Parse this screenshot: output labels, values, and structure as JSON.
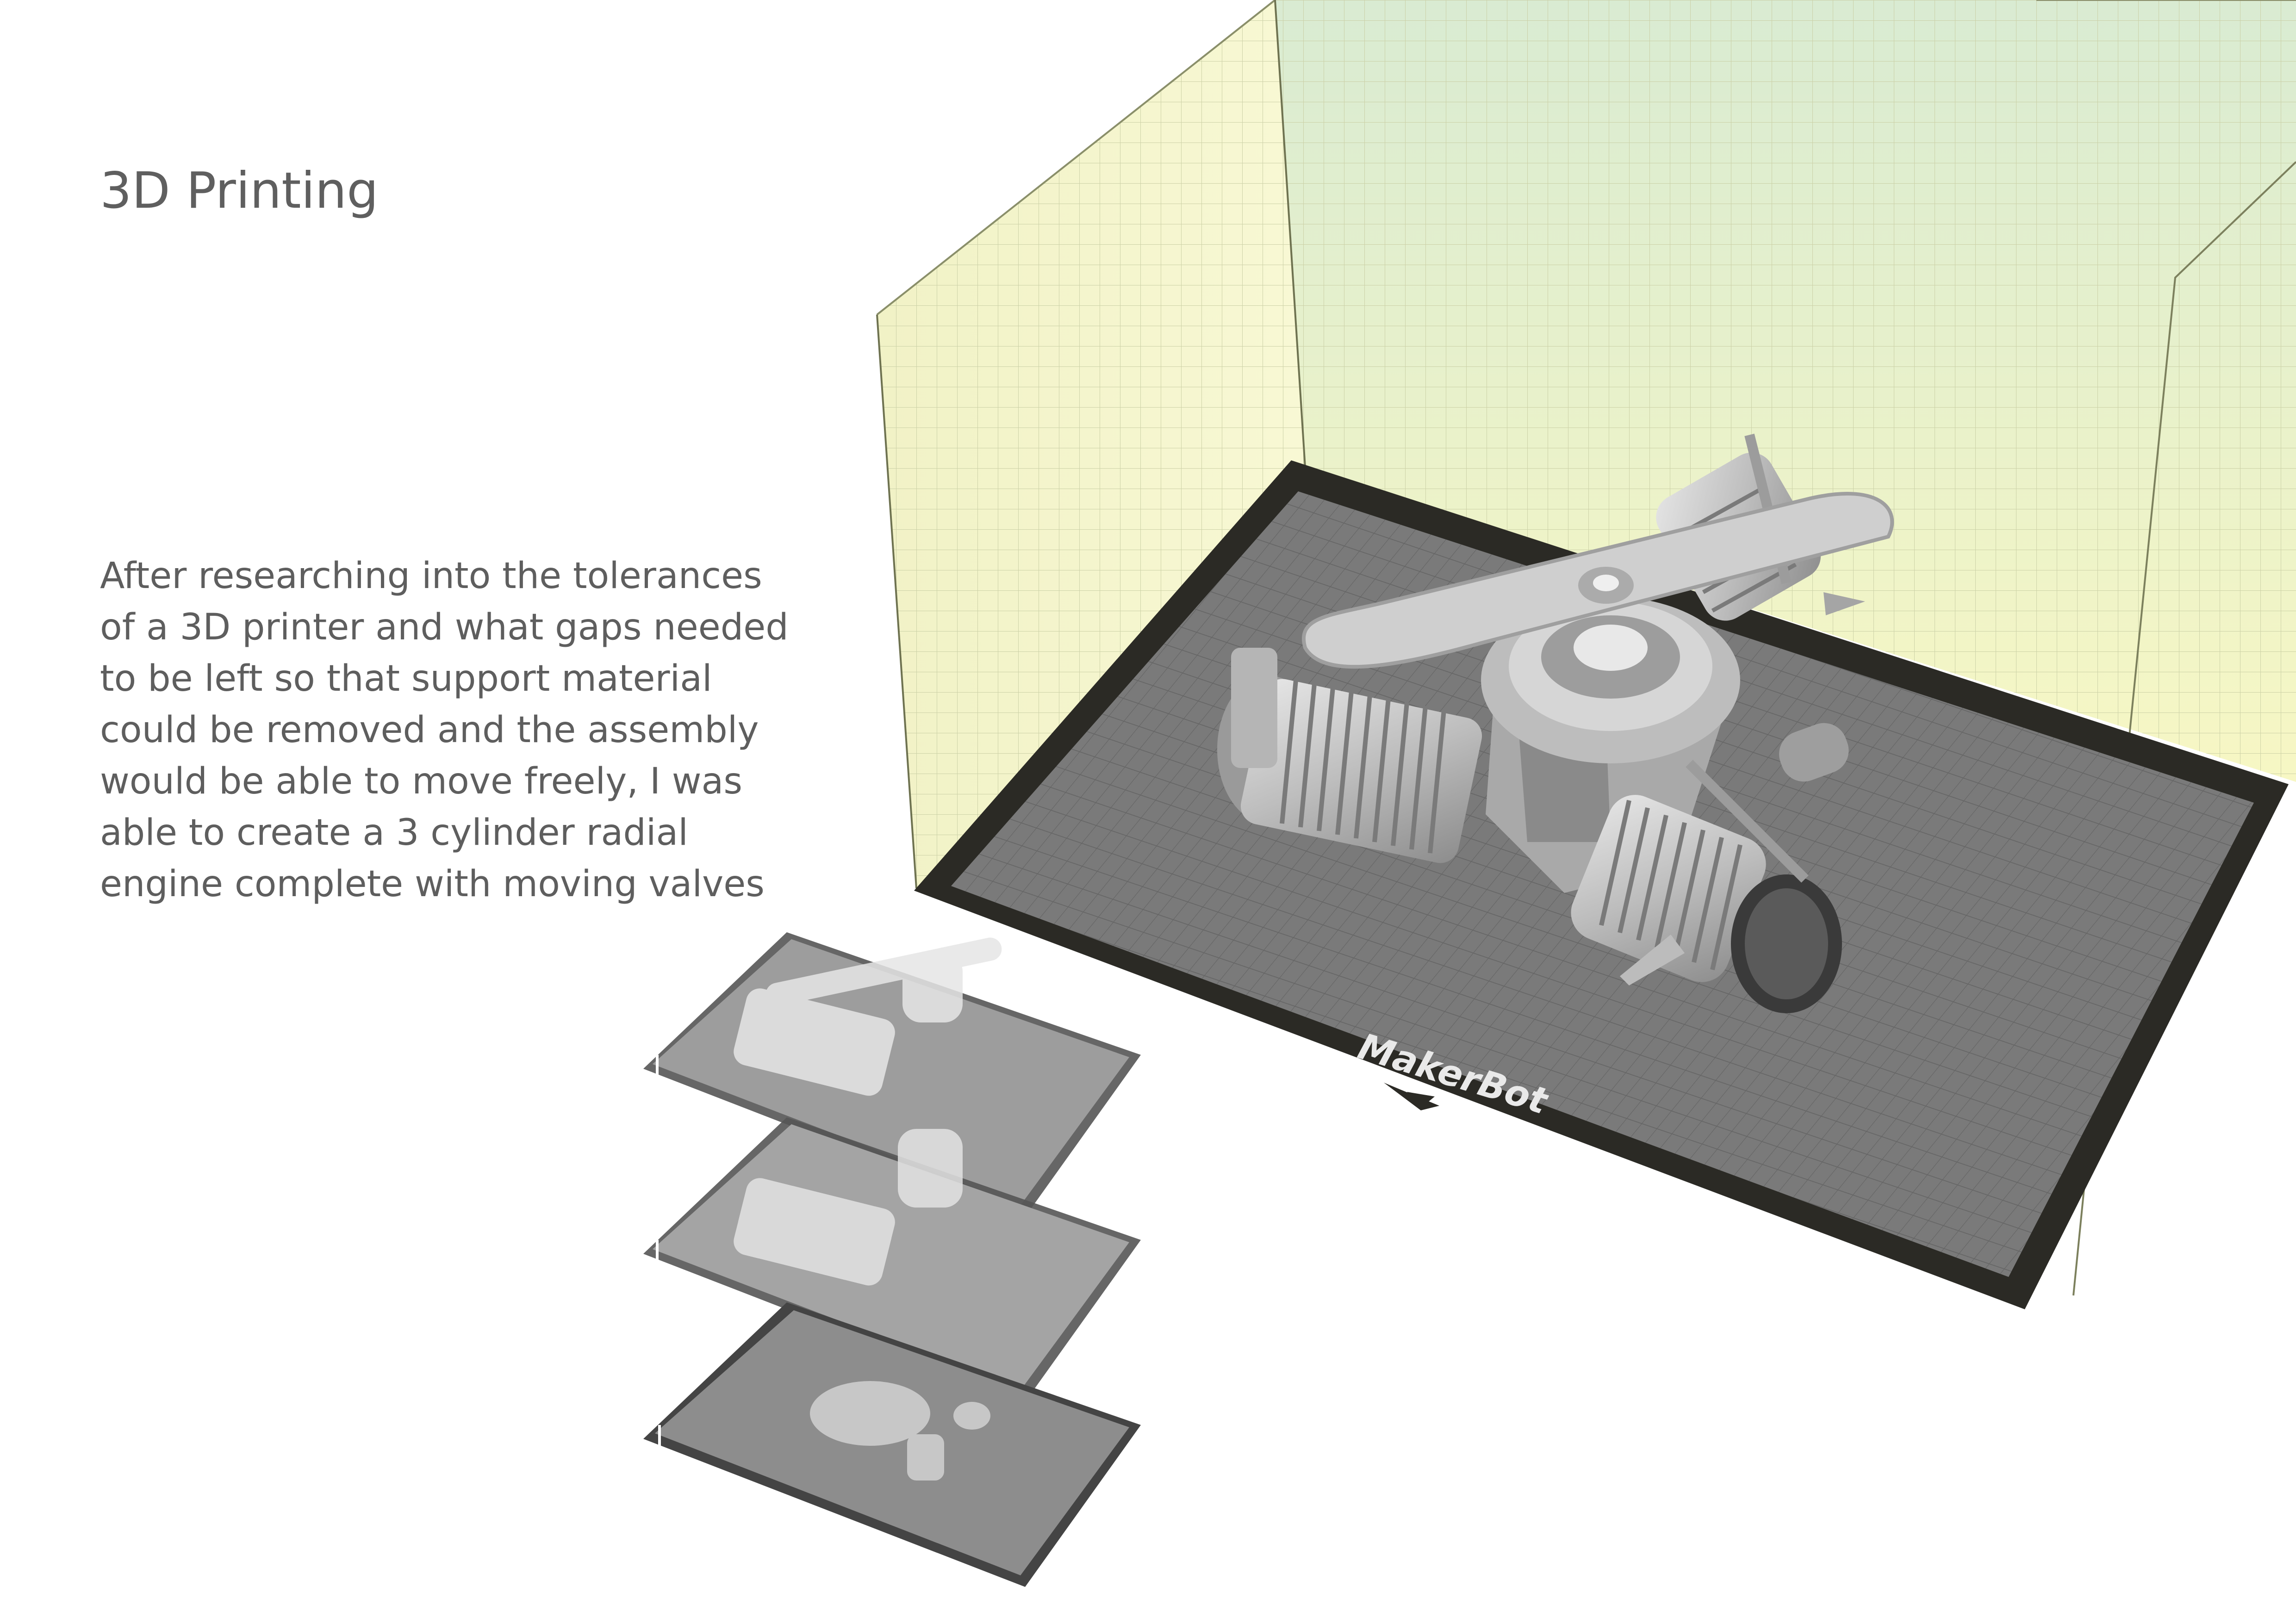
{
  "page": {
    "title": "3D Printing",
    "description_lines": [
      "After researching into the tolerances",
      "of a 3D printer and what gaps needed",
      "to be left so that support material",
      "could be removed and the assembly",
      "would be able to move freely, I was",
      "able to create a 3 cylinder radial",
      "engine complete with moving valves"
    ]
  },
  "build_plate": {
    "brand": "MakerBot",
    "frame_color": "#2b2a25",
    "bed_color": "#7a7a7a",
    "volume_tint": "#eef5c8"
  },
  "model": {
    "name": "3 cylinder radial engine",
    "color": "#c8c8c8"
  },
  "layer_previews": {
    "count": 3
  }
}
